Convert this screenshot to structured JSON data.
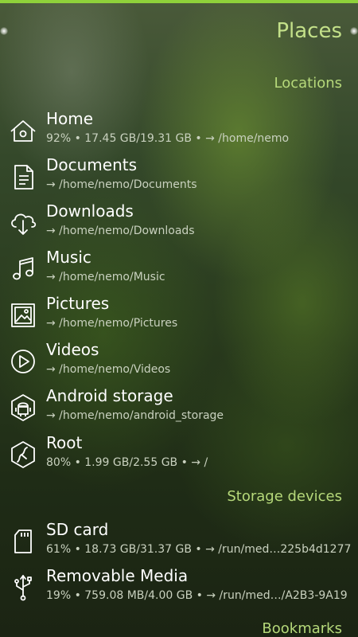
{
  "page": {
    "title": "Places"
  },
  "sections": {
    "locations": "Locations",
    "storage": "Storage devices",
    "bookmarks": "Bookmarks"
  },
  "colors": {
    "accent": "#8fd13a",
    "title": "#c3e089",
    "section": "#b6d97a"
  },
  "locations": [
    {
      "title": "Home",
      "subtitle": "92% • 17.45 GB/19.31 GB • → /home/nemo",
      "icon": "home-icon"
    },
    {
      "title": "Documents",
      "subtitle": "→ /home/nemo/Documents",
      "icon": "document-icon"
    },
    {
      "title": "Downloads",
      "subtitle": "→ /home/nemo/Downloads",
      "icon": "cloud-download-icon"
    },
    {
      "title": "Music",
      "subtitle": "→ /home/nemo/Music",
      "icon": "music-note-icon"
    },
    {
      "title": "Pictures",
      "subtitle": "→ /home/nemo/Pictures",
      "icon": "picture-icon"
    },
    {
      "title": "Videos",
      "subtitle": "→ /home/nemo/Videos",
      "icon": "play-circle-icon"
    },
    {
      "title": "Android storage",
      "subtitle": "→ /home/nemo/android_storage",
      "icon": "android-icon"
    },
    {
      "title": "Root",
      "subtitle": "80% • 1.99 GB/2.55 GB • → /",
      "icon": "root-icon"
    }
  ],
  "storage": [
    {
      "title": "SD card",
      "subtitle": "61% • 18.73 GB/31.37 GB • → /run/med…225b4d1277",
      "icon": "sd-card-icon"
    },
    {
      "title": "Removable Media",
      "subtitle": "19% • 759.08 MB/4.00 GB • → /run/med…/A2B3-9A19",
      "icon": "usb-icon"
    }
  ]
}
